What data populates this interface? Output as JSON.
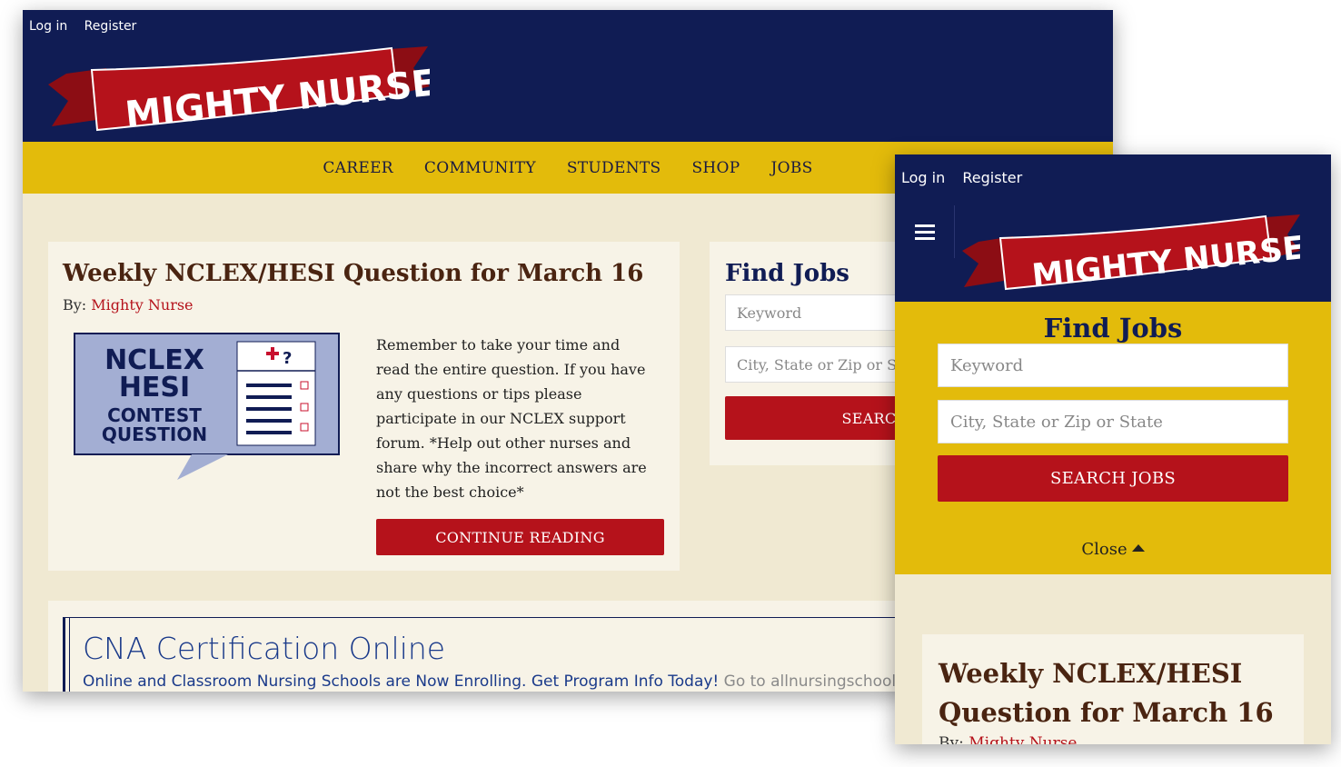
{
  "desktop": {
    "auth": {
      "login": "Log in",
      "register": "Register"
    },
    "logo_text": "MIGHTY NURSE",
    "nav": [
      "CAREER",
      "COMMUNITY",
      "STUDENTS",
      "SHOP",
      "JOBS"
    ],
    "article": {
      "title": "Weekly NCLEX/HESI Question for March 16",
      "by_label": "By:",
      "author": "Mighty Nurse",
      "thumbnail_text": [
        "NCLEX",
        "HESI",
        "CONTEST",
        "QUESTION"
      ],
      "excerpt": "Remember to take your time and read the entire question. If you have any questions or tips please participate in our NCLEX support forum. *Help out other nurses and share why the incorrect answers are not the best choice*",
      "button": "CONTINUE READING"
    },
    "find_jobs": {
      "title": "Find Jobs",
      "keyword_placeholder": "Keyword",
      "location_placeholder": "City, State or Zip or State",
      "search_button": "SEARCH JOBS"
    },
    "ad": {
      "title": "CNA Certification Online",
      "text": "Online and Classroom Nursing Schools are Now Enrolling. Get Program Info Today!",
      "link": "Go to allnursingschools.com"
    }
  },
  "mobile": {
    "auth": {
      "login": "Log in",
      "register": "Register"
    },
    "logo_text": "MIGHTY NURSE",
    "find_jobs": {
      "title": "Find Jobs",
      "keyword_placeholder": "Keyword",
      "location_placeholder": "City, State or Zip or State",
      "search_button": "SEARCH JOBS",
      "close": "Close"
    },
    "article": {
      "title": "Weekly NCLEX/HESI Question for March 16",
      "by_label": "By:",
      "author": "Mighty Nurse"
    }
  },
  "colors": {
    "navy": "#101c54",
    "gold": "#e3bb0b",
    "red": "#b5121b",
    "cream": "#f0e9d2",
    "card": "#f7f3e7",
    "brown": "#4a2411"
  }
}
